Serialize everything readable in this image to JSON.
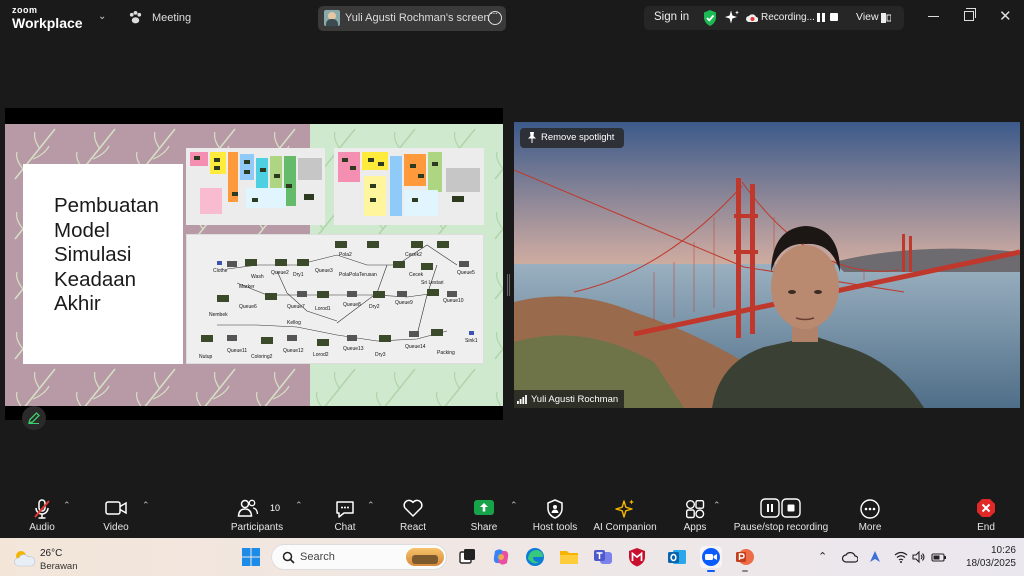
{
  "app": {
    "logo_small": "zoom",
    "logo_big": "Workplace",
    "meeting_label": "Meeting",
    "screen_title": "Yuli Agusti Rochman's screen",
    "sign_in": "Sign in",
    "recording": "Recording...",
    "view": "View"
  },
  "slide": {
    "title_lines": [
      "Pembuatan",
      "Model",
      "Simulasi",
      "Keadaan",
      "Akhir"
    ],
    "model_labels": [
      "Clothe",
      "Wash",
      "Queue2",
      "Dry1",
      "Queue3",
      "Pola2",
      "PolaPolaTerusan",
      "Cecek2",
      "Cecek",
      "Queue5",
      "Sri Lestari",
      "Marker",
      "Nembek",
      "Queue6",
      "Queue7",
      "Lorod1",
      "Queue8",
      "Dry2",
      "Queue9",
      "Queue10",
      "Kellog",
      "Nutup",
      "Queue11",
      "Coloring2",
      "Queue12",
      "Lorod2",
      "Queue13",
      "Dry3",
      "Queue14",
      "Packing",
      "Sink1"
    ]
  },
  "video": {
    "remove_spotlight": "Remove spotlight",
    "participant_name": "Yuli Agusti Rochman"
  },
  "controls": {
    "audio": "Audio",
    "video": "Video",
    "participants": "Participants",
    "participants_count": "10",
    "chat": "Chat",
    "react": "React",
    "share": "Share",
    "host_tools": "Host tools",
    "ai_companion": "AI Companion",
    "apps": "Apps",
    "pause_stop": "Pause/stop recording",
    "more": "More",
    "end": "End"
  },
  "taskbar": {
    "weather_temp": "26°C",
    "weather_desc": "Berawan",
    "search_placeholder": "Search",
    "time": "10:26",
    "date": "18/03/2025"
  },
  "colors": {
    "share_green": "#17a34a",
    "end_red": "#e02828",
    "accent_blue": "#0b5cff",
    "slide_mauve": "#b89aa6",
    "slide_mint": "#cfe9cf"
  }
}
